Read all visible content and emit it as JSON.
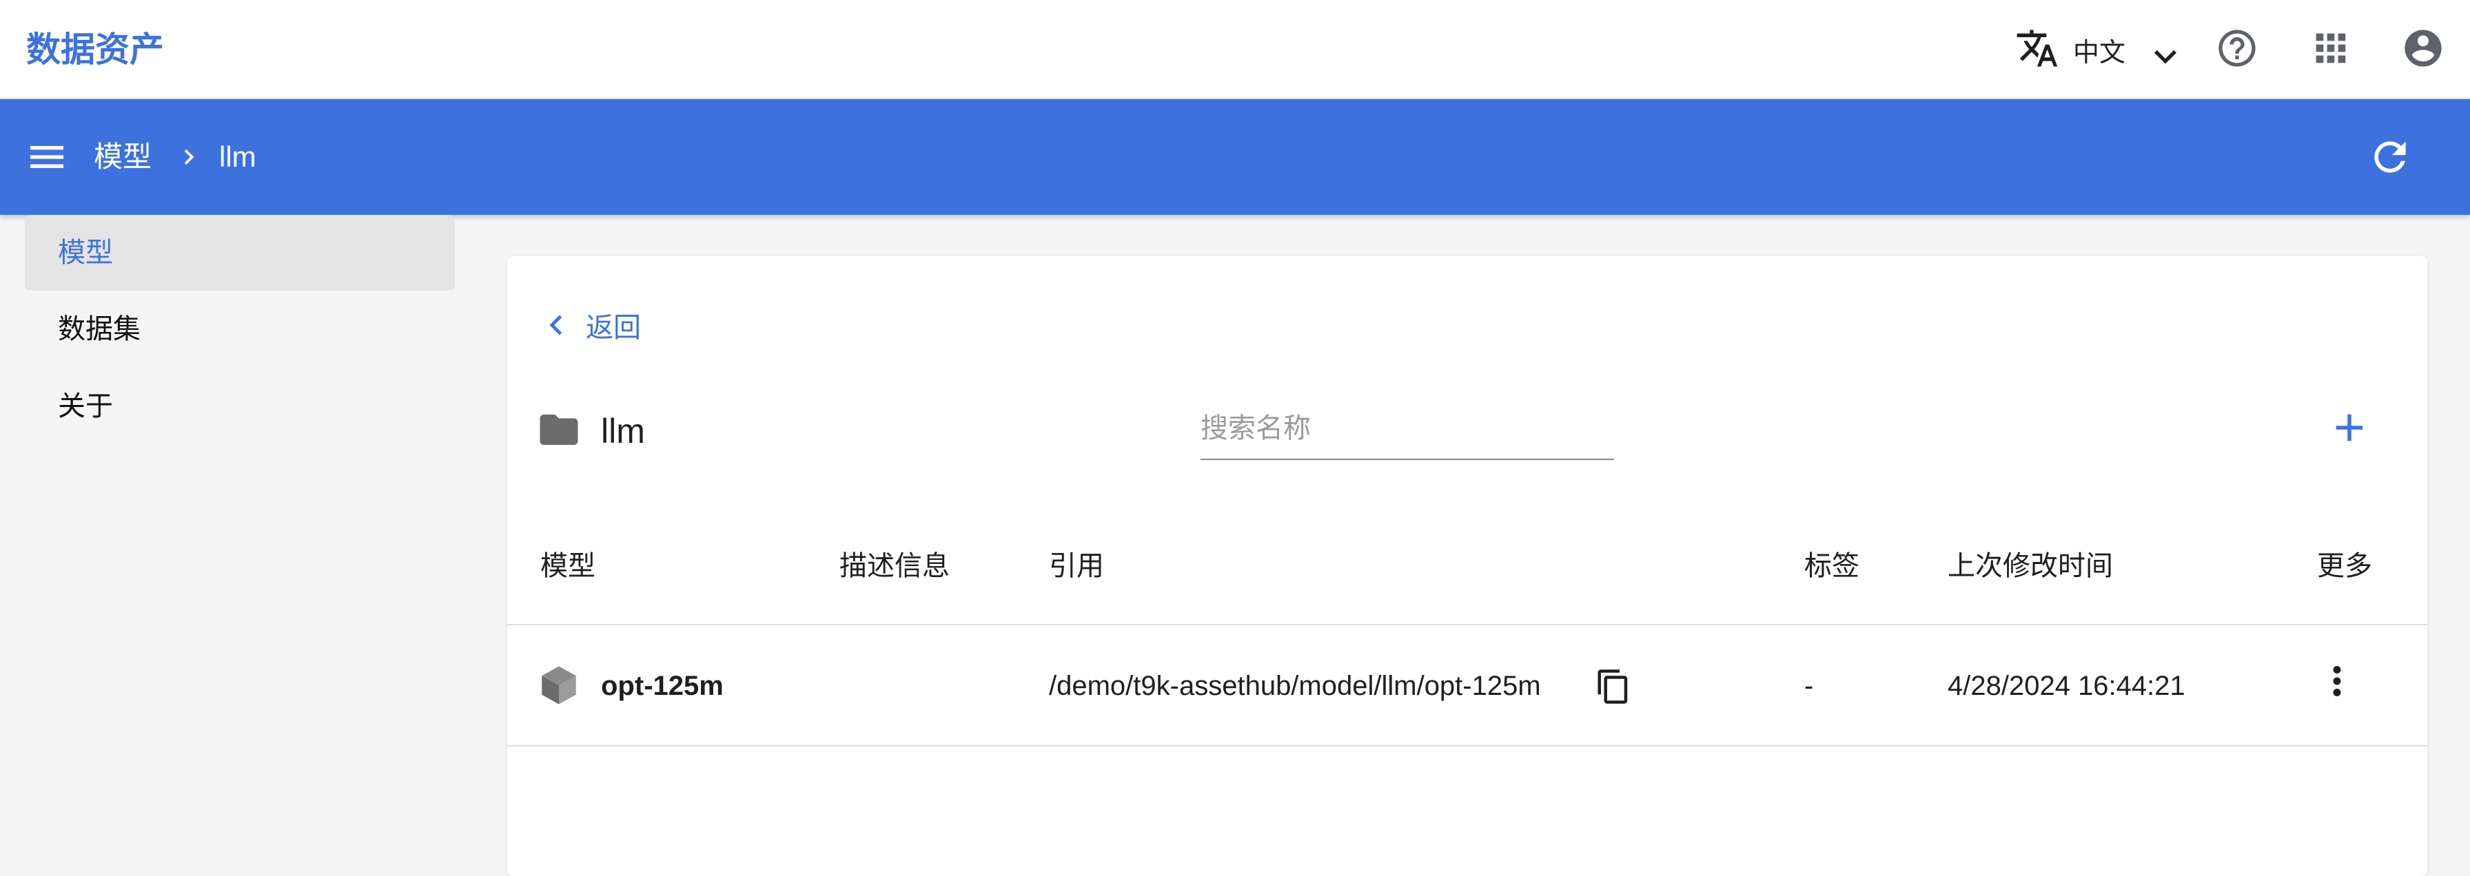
{
  "app": {
    "title": "数据资产"
  },
  "header": {
    "language": "中文",
    "icons": [
      "translate-icon",
      "chevron-down-icon",
      "help-icon",
      "apps-grid-icon",
      "account-icon"
    ]
  },
  "toolbar": {
    "breadcrumb": [
      "模型",
      "llm"
    ]
  },
  "sidebar": {
    "items": [
      {
        "label": "模型",
        "active": true
      },
      {
        "label": "数据集",
        "active": false
      },
      {
        "label": "关于",
        "active": false
      }
    ]
  },
  "main": {
    "back_label": "返回",
    "folder_name": "llm",
    "search": {
      "placeholder": "搜索名称",
      "value": ""
    },
    "table": {
      "columns": [
        "模型",
        "描述信息",
        "引用",
        "标签",
        "上次修改时间",
        "更多"
      ],
      "rows": [
        {
          "name": "opt-125m",
          "description": "",
          "reference": "/demo/t9k-assethub/model/llm/opt-125m",
          "tags": "-",
          "modified": "4/28/2024 16:44:21"
        }
      ]
    }
  },
  "colors": {
    "accent": "#3d72de",
    "toolbar": "#3d72de",
    "sidebar_active": "#e4e4e4"
  }
}
